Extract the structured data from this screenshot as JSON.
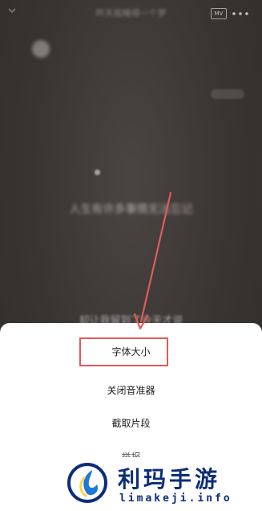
{
  "player": {
    "title": "昨天我睡得一个梦",
    "mv_badge": "MV",
    "artist": "",
    "lyrics": [
      "人生有许多事情无法忘记",
      "",
      "",
      "",
      "却让我留到了今天才说"
    ]
  },
  "menu": {
    "items": [
      {
        "label": "字体大小"
      },
      {
        "label": "关闭音准器"
      },
      {
        "label": "截取片段"
      },
      {
        "label": "举报"
      }
    ]
  },
  "watermark": {
    "title": "利玛手游",
    "url": "limakeji.info"
  },
  "colors": {
    "annotation": "#e05b57",
    "watermark_text": "#0d2d7a",
    "logo_blue": "#1e78d6"
  }
}
